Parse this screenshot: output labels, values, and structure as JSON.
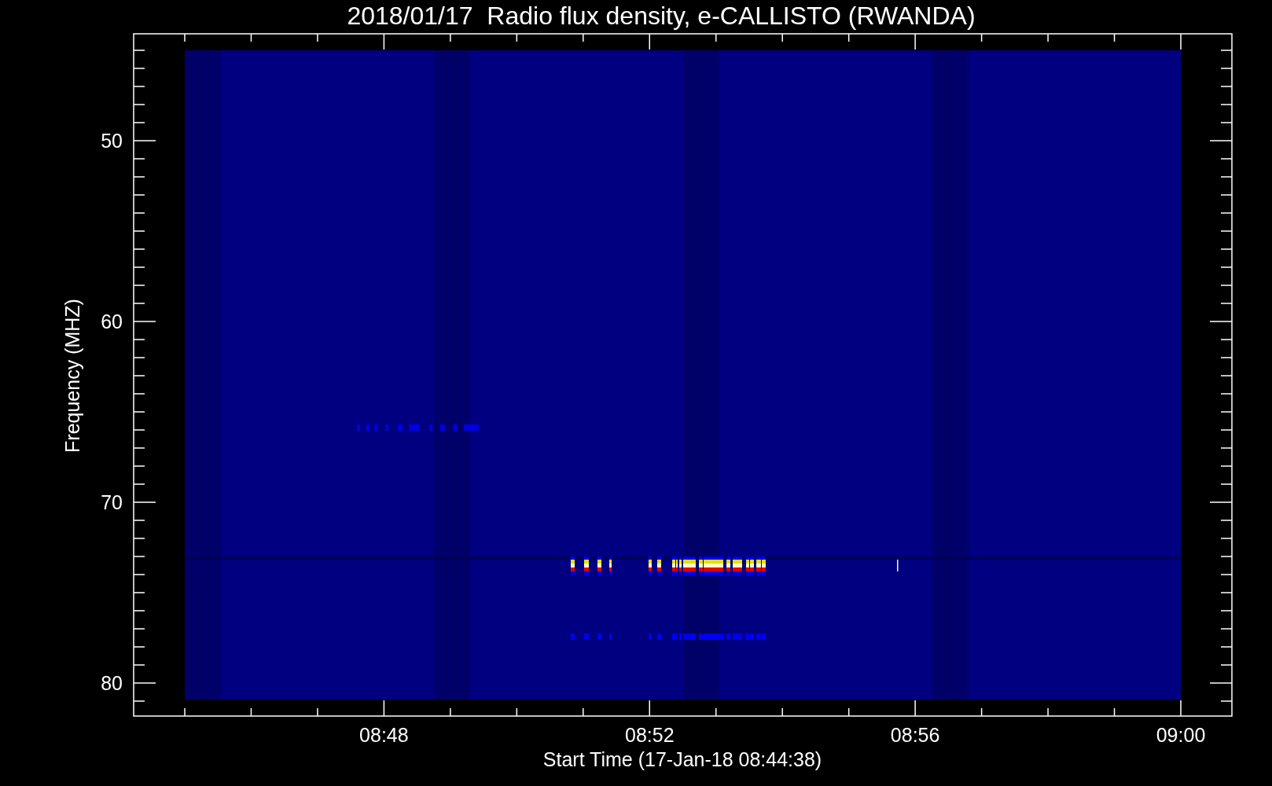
{
  "title": "2018/01/17  Radio flux density, e-CALLISTO (RWANDA)",
  "y_axis": {
    "label": "Frequency (MHZ)",
    "ticks": [
      "50",
      "60",
      "70",
      "80"
    ]
  },
  "x_axis": {
    "label": "Start Time (17-Jan-18 08:44:38)",
    "ticks": [
      "08:48",
      "08:52",
      "08:56",
      "09:00"
    ]
  }
}
